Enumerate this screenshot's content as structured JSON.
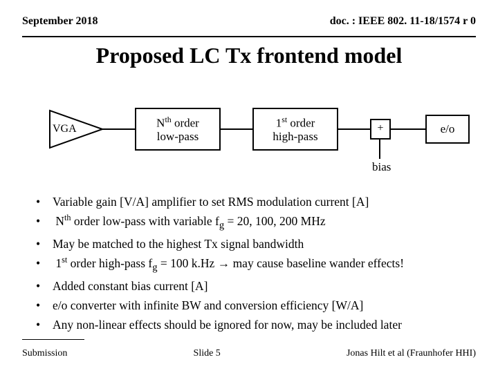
{
  "header": {
    "date": "September 2018",
    "docid": "doc. : IEEE 802. 11-18/1574 r 0"
  },
  "title": "Proposed LC Tx frontend model",
  "diagram": {
    "vga": "VGA",
    "box1_l1_pre": "N",
    "box1_l1_sup": "th",
    "box1_l1_post": " order",
    "box1_l2": "low-pass",
    "box2_l1_pre": "1",
    "box2_l1_sup": "st",
    "box2_l1_post": " order",
    "box2_l2": "high-pass",
    "sum": "+",
    "bias": "bias",
    "eo": "e/o"
  },
  "bullets": {
    "b1": "Variable gain [V/A] amplifier to set RMS modulation current [A]",
    "b2_pre": "N",
    "b2_sup": "th",
    "b2_mid": " order low-pass with variable f",
    "b2_sub": "g",
    "b2_post": " = 20, 100, 200 MHz",
    "b3": "May be matched to the highest Tx signal bandwidth",
    "b4_pre": "1",
    "b4_sup": "st",
    "b4_mid": " order high-pass f",
    "b4_sub": "g",
    "b4_post": " = 100 k.Hz → may cause baseline wander effects!",
    "b5": "Added constant bias current [A]",
    "b6": "e/o converter with infinite BW and conversion efficiency [W/A]",
    "b7": "Any non-linear effects should be ignored for now, may be included later"
  },
  "footer": {
    "submission": "Submission",
    "slide": "Slide 5",
    "author": "Jonas Hilt et al (Fraunhofer HHI)"
  }
}
